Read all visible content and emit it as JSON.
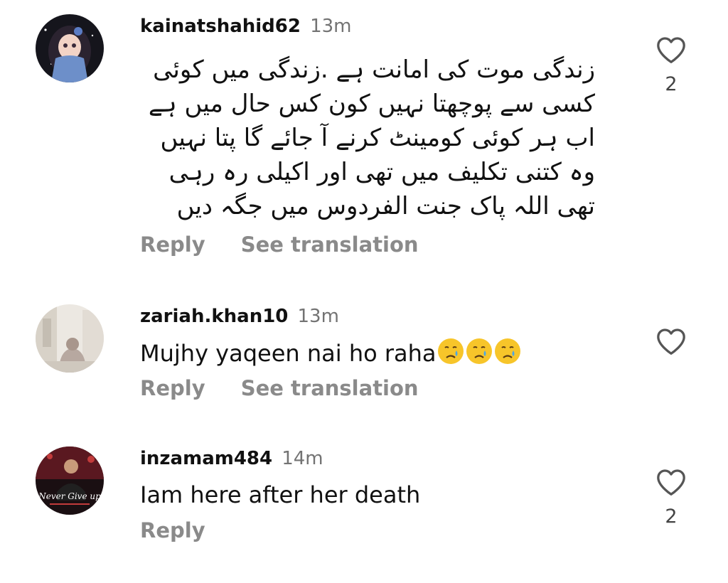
{
  "comments": [
    {
      "username": "kainatshahid62",
      "time": "13m",
      "text": "زندگی موت کی امانت ہے .زندگی میں کوئی کسی سے پوچھتا نہیں کون کس حال میں ہے اب ہر کوئی کومینٹ کرنے آ جائے گا پتا نہیں وہ کتنی تکلیف میں تھی اور اکیلی رہ رہی تھی اللہ پاک جنت الفردوس میں جگہ دیں",
      "reply_label": "Reply",
      "translate_label": "See translation",
      "likes": "2"
    },
    {
      "username": "zariah.khan10",
      "time": "13m",
      "text": "Mujhy yaqeen nai ho raha",
      "emojis": [
        "crying-face",
        "crying-face",
        "crying-face"
      ],
      "reply_label": "Reply",
      "translate_label": "See translation",
      "likes": ""
    },
    {
      "username": "inzamam484",
      "time": "14m",
      "text": "Iam here after her death",
      "avatar_caption": "Never Give up",
      "reply_label": "Reply",
      "likes": "2"
    }
  ],
  "colors": {
    "username": "#111111",
    "secondary": "#737373",
    "action": "#8a8a8a"
  }
}
